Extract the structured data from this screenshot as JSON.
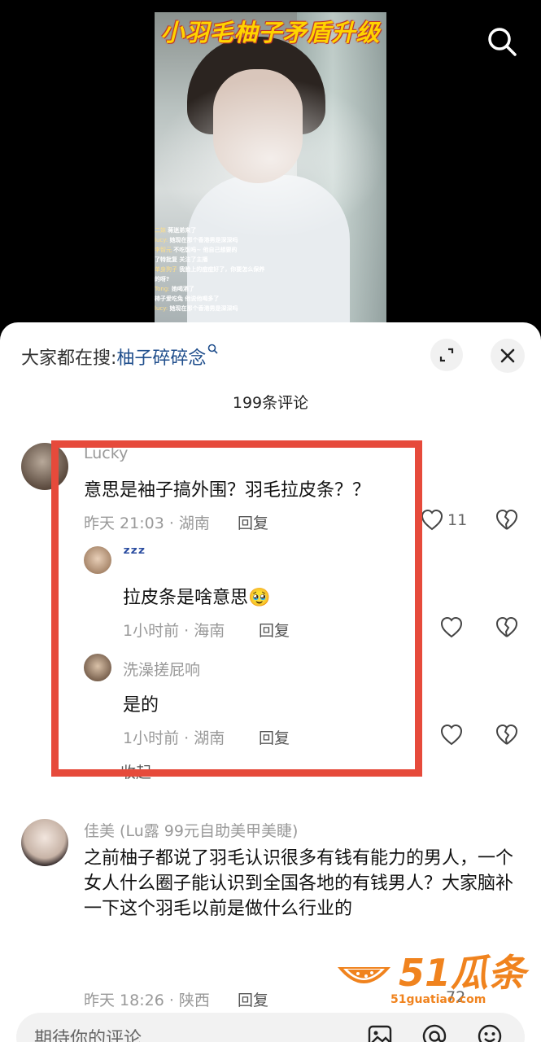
{
  "video": {
    "title_overlay": "小羽毛柚子矛盾升级",
    "chat": [
      {
        "user": "二妹",
        "text": "蒋迷弟来了"
      },
      {
        "user": "lucy:",
        "text": "她现在那个香港男是深深吗"
      },
      {
        "user": "李智元",
        "text": "不吃饭吗~ 他自己想要的"
      },
      {
        "user": "",
        "text": "了特批复 关注了主播"
      },
      {
        "user": "单身狗子",
        "text": "我脸上的痘痘好了，你要怎么保养"
      },
      {
        "user": "",
        "text": "的呀?"
      },
      {
        "user": "Tong:",
        "text": "她喝酒了"
      },
      {
        "user": "",
        "text": "柿子爱吃兔  他说他喝多了"
      },
      {
        "user": "lucy:",
        "text": "她现在那个香港男是深深吗"
      }
    ]
  },
  "sheet": {
    "search_prefix": "大家都在搜:",
    "search_keyword": "柚子碎碎念",
    "comment_count": "199条评论"
  },
  "comments": [
    {
      "name": "Lucky",
      "text": "意思是袖子搞外围？羽毛拉皮条？？",
      "meta": "昨天 21:03 · 湖南",
      "reply": "回复",
      "likes": "11",
      "replies": [
        {
          "name": "ᶻᶻᶻ",
          "text": "拉皮条是啥意思🥹",
          "meta": "1小时前 · 海南",
          "reply": "回复"
        },
        {
          "name": "洗澡搓屁响",
          "text": "是的",
          "meta": "1小时前 · 湖南",
          "reply": "回复"
        }
      ],
      "collapse": "收起"
    },
    {
      "name": "佳美 (Lu露 99元自助美甲美睫)",
      "text": "之前柚子都说了羽毛认识很多有钱有能力的男人，一个女人什么圈子能认识到全国各地的有钱男人？大家脑补一下这个羽毛以前是做什么行业的",
      "meta": "昨天 18:26 · 陕西",
      "reply": "回复",
      "likes": "72"
    }
  ],
  "watermark": {
    "brand": "51瓜条",
    "url": "51guatiao.com"
  },
  "input": {
    "placeholder": "期待你的评论"
  },
  "icons": {
    "search": "search-icon",
    "expand": "expand-icon",
    "close": "close-icon",
    "like": "heart-icon",
    "dislike": "broken-heart-icon",
    "image": "image-icon",
    "mention": "at-icon",
    "emoji": "emoji-icon"
  },
  "colors": {
    "highlight": "#e64a3b",
    "keyword": "#1f4e8c",
    "watermark": "#f0831e",
    "title": "#ffd400"
  }
}
